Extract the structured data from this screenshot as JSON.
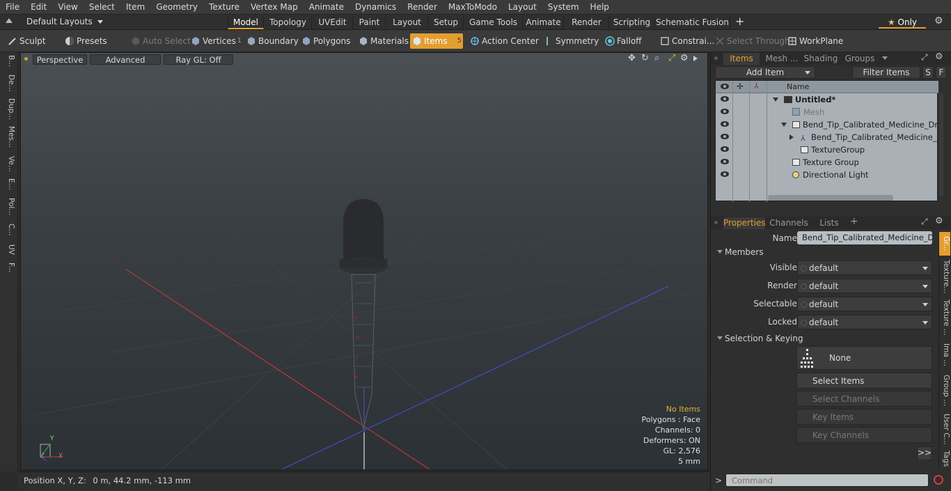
{
  "menu": [
    "File",
    "Edit",
    "View",
    "Select",
    "Item",
    "Geometry",
    "Texture",
    "Vertex Map",
    "Animate",
    "Dynamics",
    "Render",
    "MaxToModo",
    "Layout",
    "System",
    "Help"
  ],
  "layout_bar": {
    "layouts_label": "Default Layouts",
    "tabs": [
      "Model",
      "Topology",
      "UVEdit",
      "Paint",
      "Layout",
      "Setup",
      "Game Tools",
      "Animate",
      "Render",
      "Scripting",
      "Schematic Fusion"
    ],
    "active_tab": "Model",
    "only_label": "Only"
  },
  "toolbar": {
    "sculpt": "Sculpt",
    "presets": "Presets",
    "auto_select": "Auto Select",
    "vertices": "Vertices",
    "vertices_count": "1",
    "boundary": "Boundary",
    "polygons": "Polygons",
    "materials": "Materials",
    "items": "Items",
    "items_count": "5",
    "action_center": "Action Center",
    "symmetry": "Symmetry",
    "falloff": "Falloff",
    "constraints": "Constrai...",
    "select_through": "Select Through",
    "workplane": "WorkPlane"
  },
  "left_tabs": [
    "B...",
    "De...",
    "Dup...",
    "Mes...",
    "Ve...",
    "E...",
    "Pol...",
    "C...",
    "UV",
    "F..."
  ],
  "viewport": {
    "perspective": "Perspective",
    "advanced": "Advanced",
    "ray_gl": "Ray GL: Off",
    "stats": {
      "no_items": "No Items",
      "polygons": "Polygons : Face",
      "channels": "Channels: 0",
      "deformers": "Deformers: ON",
      "gl": "GL: 2,576",
      "scale": "5 mm"
    },
    "axis_x": "X",
    "axis_y": "Y",
    "axis_z": "Z"
  },
  "status": {
    "position_label": "Position X, Y, Z:",
    "position_value": "0 m, 44.2 mm, -113 mm"
  },
  "items_panel": {
    "tabs": [
      "Items",
      "Mesh ...",
      "Shading",
      "Groups"
    ],
    "add_item": "Add Item",
    "filter_items": "Filter Items",
    "s_btn": "S",
    "f_btn": "F",
    "col_name": "Name",
    "rows": [
      {
        "label": "Untitled*",
        "indent": 0
      },
      {
        "label": "Mesh",
        "indent": 1
      },
      {
        "label": "Bend_Tip_Calibrated_Medicine_Dropp...",
        "indent": 1
      },
      {
        "label": "Bend_Tip_Calibrated_Medicine_Dro...",
        "indent": 2
      },
      {
        "label": "TextureGroup",
        "indent": 2
      },
      {
        "label": "Texture Group",
        "indent": 1
      },
      {
        "label": "Directional Light",
        "indent": 1
      }
    ]
  },
  "props_panel": {
    "tabs": [
      "Properties",
      "Channels",
      "Lists"
    ],
    "name_label": "Name",
    "name_value": "Bend_Tip_Calibrated_Medicine_Dropp",
    "members": "Members",
    "visible_label": "Visible",
    "visible_value": "default",
    "render_label": "Render",
    "render_value": "default",
    "selectable_label": "Selectable",
    "selectable_value": "default",
    "locked_label": "Locked",
    "locked_value": "default",
    "selection_keying": "Selection & Keying",
    "none": "None",
    "select_items": "Select Items",
    "select_channels": "Select Channels",
    "key_items": "Key Items",
    "key_channels": "Key Channels",
    "more": ">>",
    "side_tabs": [
      "Gr...",
      "Texture...",
      "Texture ...",
      "Ima ...",
      "Group ...",
      "User C...",
      "Tags"
    ]
  },
  "command": {
    "placeholder": "Command"
  },
  "colors": {
    "accent": "#e39e31",
    "tree_bg": "#a9b0b6",
    "x_axis": "#d23a3a",
    "z_axis": "#3f55d8"
  }
}
